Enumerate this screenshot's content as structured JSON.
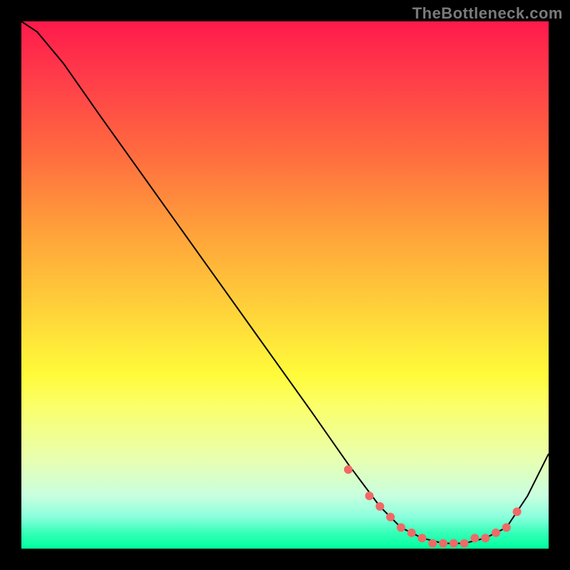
{
  "watermark": "TheBottleneck.com",
  "chart_data": {
    "type": "line",
    "title": "",
    "xlabel": "",
    "ylabel": "",
    "xlim": [
      0,
      100
    ],
    "ylim": [
      0,
      100
    ],
    "x": [
      0,
      3,
      8,
      15,
      25,
      35,
      45,
      55,
      62,
      68,
      72,
      76,
      80,
      84,
      88,
      92,
      96,
      100
    ],
    "y": [
      100,
      98,
      92,
      82,
      68,
      54,
      40,
      26,
      16,
      8,
      4,
      2,
      1,
      1,
      2,
      4,
      10,
      18
    ],
    "markers": {
      "x": [
        62,
        66,
        68,
        70,
        72,
        74,
        76,
        78,
        80,
        82,
        84,
        86,
        88,
        90,
        92,
        94
      ],
      "y": [
        15,
        10,
        8,
        6,
        4,
        3,
        2,
        1,
        1,
        1,
        1,
        2,
        2,
        3,
        4,
        7
      ]
    },
    "background_gradient": [
      "#ff1a4b",
      "#ffd33a",
      "#00ff9c"
    ]
  }
}
